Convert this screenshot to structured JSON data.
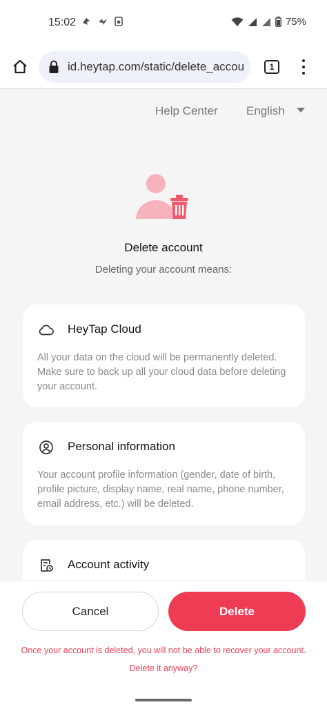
{
  "status_bar": {
    "time": "15:02",
    "battery": "75%",
    "icons_left": [
      "notification-icon",
      "notification-icon",
      "speaker-icon"
    ],
    "icons_right": [
      "wifi-icon",
      "signal-icon",
      "signal-icon",
      "battery-icon"
    ]
  },
  "browser": {
    "url": "id.heytap.com/static/delete_account",
    "tab_count": "1"
  },
  "header": {
    "help_center": "Help Center",
    "language": "English"
  },
  "main": {
    "title": "Delete account",
    "subtitle": "Deleting your account means:",
    "accent_color": "#ef3c55"
  },
  "cards": [
    {
      "icon": "cloud-icon",
      "title": "HeyTap Cloud",
      "body": "All your data on the cloud will be permanently deleted. Make sure to back up all your cloud data before deleting your account."
    },
    {
      "icon": "person-icon",
      "title": "Personal information",
      "body": "Your account profile information (gender, date of birth, profile picture, display name, real name, phone number, email address, etc.) will be deleted."
    },
    {
      "icon": "activity-log-icon",
      "title": "Account activity",
      "body": ""
    }
  ],
  "footer": {
    "cancel_label": "Cancel",
    "delete_label": "Delete",
    "warning": "Once your account is deleted, you will not be able to recover your account. Delete it anyway?"
  }
}
